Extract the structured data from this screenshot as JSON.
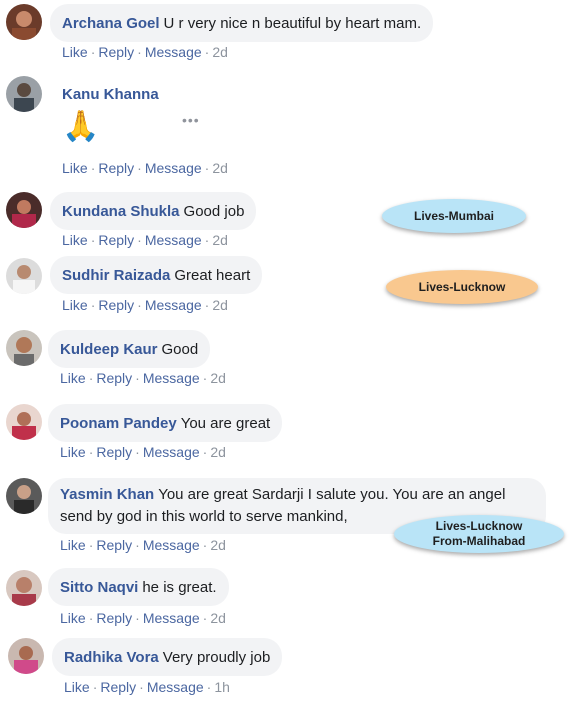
{
  "comments": [
    {
      "author": "Archana Goel",
      "text": "U r very nice n beautiful by heart mam.",
      "time": "2d"
    },
    {
      "author": "Kanu Khanna",
      "text": "",
      "emoji": "🙏",
      "more": "•••",
      "time": "2d"
    },
    {
      "author": "Kundana Shukla",
      "text": "Good job",
      "time": "2d"
    },
    {
      "author": "Sudhir Raizada",
      "text": "Great heart",
      "time": "2d"
    },
    {
      "author": "Kuldeep Kaur",
      "text": "Good",
      "time": "2d"
    },
    {
      "author": "Poonam Pandey",
      "text": "You are great",
      "time": "2d"
    },
    {
      "author": "Yasmin Khan",
      "text": "You are great Sardarji I salute you. You are an angel send by god in this world to serve mankind,",
      "time": "2d"
    },
    {
      "author": "Sitto Naqvi",
      "text": "he is great.",
      "time": "2d"
    },
    {
      "author": "Radhika Vora",
      "text": "Very proudly job",
      "time": "1h"
    }
  ],
  "actions": {
    "like": "Like",
    "reply": "Reply",
    "message": "Message",
    "sep": "·"
  },
  "tags": [
    {
      "text": "Lives-Mumbai",
      "color": "#b9e4f7"
    },
    {
      "text": "Lives-Lucknow",
      "color": "#f9c88f"
    },
    {
      "line1": "Lives-Lucknow",
      "line2": "From-Malihabad",
      "color": "#b9e4f7"
    }
  ],
  "colors": {
    "author": "#385898",
    "link": "#4b67a1",
    "bubble": "#f2f3f5"
  }
}
